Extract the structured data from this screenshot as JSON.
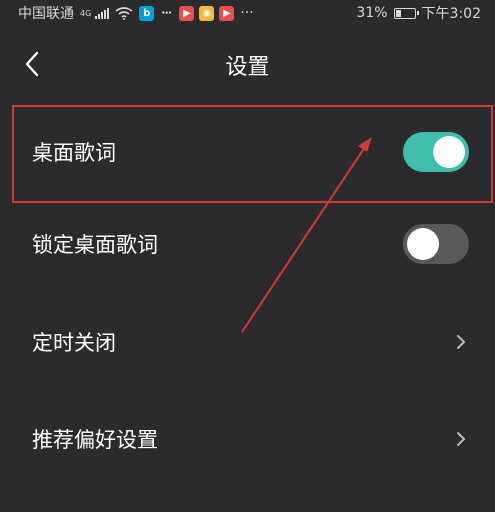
{
  "status_bar": {
    "carrier": "中国联通",
    "network_type": "4G",
    "extra_icon": "···",
    "battery_percent": "31%",
    "battery_level": 0.31,
    "time": "下午3:02",
    "app_icons": [
      {
        "icon": "bilibili-icon",
        "glyph": "b",
        "color": "#00a1d6"
      },
      {
        "icon": "chat-bubble-icon",
        "glyph": "⋯",
        "color": "#2b2b2e"
      },
      {
        "icon": "video-app-icon",
        "glyph": "▶",
        "color": "#e94d4d"
      },
      {
        "icon": "yellow-app-icon",
        "glyph": "◉",
        "color": "#f4b83a"
      },
      {
        "icon": "video-app-icon-2",
        "glyph": "▶",
        "color": "#e94d4d"
      }
    ]
  },
  "header": {
    "title": "设置",
    "back_icon": "chevron-left-icon"
  },
  "settings": [
    {
      "label": "桌面歌词",
      "control": "toggle",
      "enabled": true
    },
    {
      "label": "锁定桌面歌词",
      "control": "toggle",
      "enabled": false
    },
    {
      "label": "定时关闭",
      "control": "chevron"
    },
    {
      "label": "推荐偏好设置",
      "control": "chevron"
    }
  ],
  "colors": {
    "background": "#2b2b2e",
    "toggle_on": "#3fbfa9",
    "toggle_off": "#59595c",
    "annotation": "#d23a3a"
  }
}
